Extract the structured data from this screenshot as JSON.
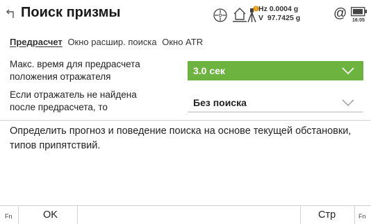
{
  "header": {
    "title": "Поиск призмы",
    "hz": "Hz 0.0004 g",
    "v": "V  97.7425 g",
    "at_symbol": "@",
    "time": "16:05",
    "icons": [
      "back-arrow-icon",
      "target-circle-icon",
      "home-icon",
      "tripod-alert-icon",
      "battery-icon"
    ],
    "alert_color": "#f39200"
  },
  "tabs": [
    {
      "label": "Предрасчет",
      "active": true
    },
    {
      "label": "Окно расшир. поиска",
      "active": false
    },
    {
      "label": "Окно ATR",
      "active": false
    }
  ],
  "form": {
    "row1": {
      "label_line1": "Макс. время для предрасчета",
      "label_line2": "положения отражателя",
      "value": "3.0 сек"
    },
    "row2": {
      "label_line1": "Если отражатель не найдена",
      "label_line2": "после предрасчета, то",
      "value": "Без поиска"
    },
    "accent_color": "#6cb33f"
  },
  "description": "Определить прогноз и поведение поиска на основе текущей обстановки, типов припятствий.",
  "softkeys": {
    "fn_left": "Fn",
    "ok": "OK",
    "page": "Стр",
    "fn_right": "Fn"
  }
}
